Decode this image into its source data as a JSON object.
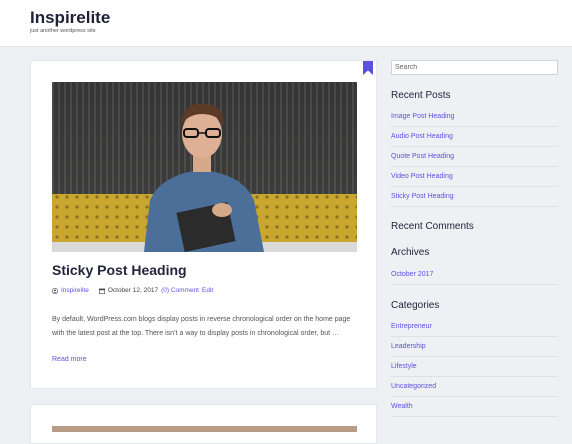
{
  "site": {
    "title": "Inspirelite",
    "description": "just another wordpress site"
  },
  "post": {
    "title": "Sticky Post Heading",
    "author": "Inspirelite",
    "date": "October 12, 2017",
    "comments": "(0) Comment",
    "edit": "Edit",
    "excerpt": "By default, WordPress.com blogs display posts in reverse chronological order on the home page with the latest post at the top. There isn’t a way to display posts in chronological order, but …",
    "read_more": "Read more"
  },
  "sidebar": {
    "search_placeholder": "Search",
    "recent_posts_title": "Recent Posts",
    "recent_posts": [
      "Image Post Heading",
      "Audio Post Heading",
      "Quote Post Heading",
      "Video Post Heading",
      "Sticky Post Heading"
    ],
    "recent_comments_title": "Recent Comments",
    "archives_title": "Archives",
    "archives": [
      "October 2017"
    ],
    "categories_title": "Categories",
    "categories": [
      "Entrepreneur",
      "Leadership",
      "Lifestyle",
      "Uncategorized",
      "Wealth"
    ]
  },
  "colors": {
    "accent": "#5b52e0",
    "background": "#eef0f4"
  }
}
